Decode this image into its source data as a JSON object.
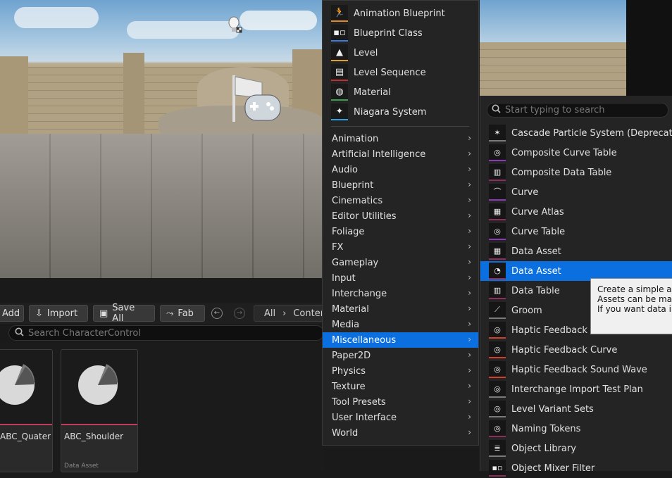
{
  "main_menu": {
    "top_items": [
      {
        "label": "Animation Blueprint",
        "icon": "running-figure-icon"
      },
      {
        "label": "Blueprint Class",
        "icon": "blueprint-nodes-icon"
      },
      {
        "label": "Level",
        "icon": "mountains-icon"
      },
      {
        "label": "Level Sequence",
        "icon": "film-sequence-icon"
      },
      {
        "label": "Material",
        "icon": "checker-sphere-icon"
      },
      {
        "label": "Niagara System",
        "icon": "particle-sparkle-icon"
      }
    ],
    "categories": [
      "Animation",
      "Artificial Intelligence",
      "Audio",
      "Blueprint",
      "Cinematics",
      "Editor Utilities",
      "Foliage",
      "FX",
      "Gameplay",
      "Input",
      "Interchange",
      "Material",
      "Media",
      "Miscellaneous",
      "Paper2D",
      "Physics",
      "Texture",
      "Tool Presets",
      "User Interface",
      "World"
    ],
    "selected_category": "Miscellaneous"
  },
  "sub_menu": {
    "search_placeholder": "Start typing to search",
    "items": [
      "Cascade Particle System (Deprecated)",
      "Composite Curve Table",
      "Composite Data Table",
      "Curve",
      "Curve Atlas",
      "Curve Table",
      "Data Asset",
      "Data Asset",
      "Data Table",
      "Groom",
      "Haptic Feedback Buffer",
      "Haptic Feedback Curve",
      "Haptic Feedback Sound Wave",
      "Interchange Import Test Plan",
      "Level Variant Sets",
      "Naming Tokens",
      "Object Library",
      "Object Mixer Filter"
    ],
    "selected_index": 7
  },
  "tooltip": {
    "line1": "Create a simple asset",
    "line2": "Assets can be made",
    "line3": "If you want data inh"
  },
  "content_browser": {
    "add_label": "Add",
    "import_label": "Import",
    "save_all_label": "Save All",
    "fab_label": "Fab",
    "path_all": "All",
    "path_content": "Content",
    "search_placeholder": "Search CharacterControl",
    "assets": [
      {
        "name": "ABC_Quater",
        "type": ""
      },
      {
        "name": "ABC_Shoulder",
        "type": "Data Asset"
      }
    ]
  }
}
